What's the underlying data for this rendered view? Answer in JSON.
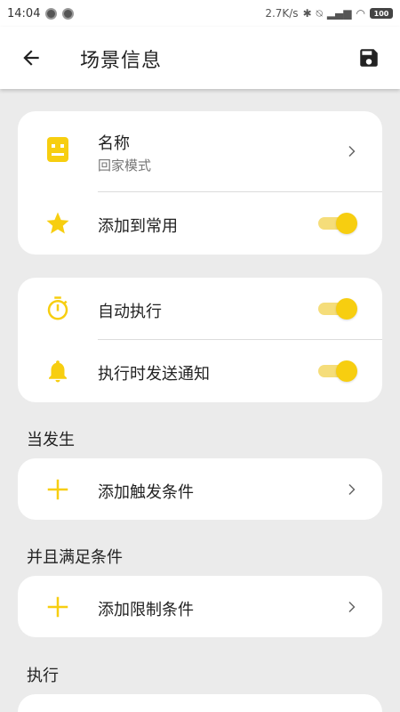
{
  "status": {
    "time": "14:04",
    "net_speed": "2.7K/s",
    "battery": "100"
  },
  "appbar": {
    "title": "场景信息"
  },
  "card_name": {
    "label": "名称",
    "value": "回家模式",
    "favorite_label": "添加到常用",
    "favorite_on": true
  },
  "card_exec": {
    "auto_label": "自动执行",
    "auto_on": true,
    "notify_label": "执行时发送通知",
    "notify_on": true
  },
  "section_trigger": {
    "title": "当发生",
    "add_label": "添加触发条件"
  },
  "section_condition": {
    "title": "并且满足条件",
    "add_label": "添加限制条件"
  },
  "section_action": {
    "title": "执行"
  },
  "colors": {
    "accent": "#f7ce10",
    "accent_light": "#f5dd7a",
    "background": "#ebebeb"
  }
}
